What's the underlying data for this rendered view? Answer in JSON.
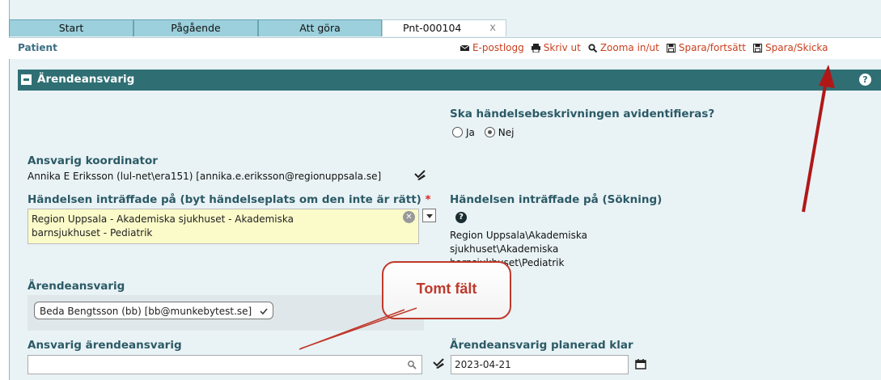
{
  "tabs": [
    {
      "label": "Start"
    },
    {
      "label": "Pågående"
    },
    {
      "label": "Att göra"
    },
    {
      "label": "Pnt-000104",
      "close": "x"
    }
  ],
  "subbar": {
    "patient": "Patient",
    "actions": [
      {
        "label": "E-postlogg",
        "icon": "envelope-icon"
      },
      {
        "label": "Skriv ut",
        "icon": "printer-icon"
      },
      {
        "label": "Zooma in/ut",
        "icon": "search-icon"
      },
      {
        "label": "Spara/fortsätt",
        "icon": "floppy-disk-icon"
      },
      {
        "label": "Spara/Skicka",
        "icon": "floppy-disk-icon"
      }
    ]
  },
  "section": {
    "title": "Ärendeansvarig",
    "help": "?"
  },
  "form": {
    "avid_question": "Ska händelsebeskrivningen avidentifieras?",
    "avid_yes": "Ja",
    "avid_no": "Nej",
    "coordinator_label": "Ansvarig koordinator",
    "coordinator_value": "Annika E Eriksson (lul-net\\era151) [annika.e.eriksson@regionuppsala.se]",
    "location_label": "Händelsen inträffade på (byt händelseplats om den inte är rätt)",
    "location_required": "*",
    "location_value_line1": "Region Uppsala - Akademiska sjukhuset - Akademiska",
    "location_value_line2": "barnsjukhuset - Pediatrik",
    "location_search_label": "Händelsen inträffade på (Sökning)",
    "location_search_help": "?",
    "location_search_line1": "Region Uppsala\\Akademiska",
    "location_search_line2": "sjukhuset\\Akademiska",
    "location_search_line3": "barnsjukhuset\\Pediatrik",
    "case_owner_label": "Ärendeansvarig",
    "case_owner_value": "Beda Bengtsson (bb) [bb@munkebytest.se]",
    "responsible_owner_label": "Ansvarig ärendeansvarig",
    "responsible_owner_value": "",
    "planned_done_label": "Ärendeansvarig planerad klar",
    "planned_done_value": "2023-04-21"
  },
  "annotation": {
    "callout_text": "Tomt fält",
    "color": "#c0392b"
  },
  "colors": {
    "accent": "#2f6f74",
    "tab": "#9bd0dc",
    "action": "#c8401f",
    "highlight": "#fbfbc9"
  }
}
